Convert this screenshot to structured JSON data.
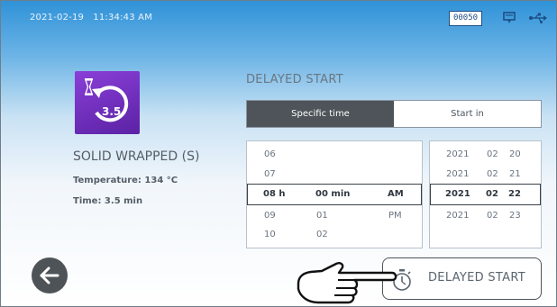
{
  "topbar": {
    "date": "2021-02-19",
    "time": "11:34:43 AM",
    "counter": "00050",
    "icons": [
      "card-icon",
      "usb-icon"
    ]
  },
  "program": {
    "icon_value": "3.5",
    "name": "SOLID WRAPPED (S)",
    "temperature": "Temperature: 134 °C",
    "time": "Time: 3.5 min"
  },
  "delayed_start": {
    "title": "DELAYED START",
    "tabs": [
      {
        "label": "Specific time",
        "active": true
      },
      {
        "label": "Start in",
        "active": false
      }
    ]
  },
  "time_picker": {
    "rows": [
      {
        "hour": "06",
        "minute": "",
        "ampm": ""
      },
      {
        "hour": "07",
        "minute": "",
        "ampm": ""
      },
      {
        "hour": "08 h",
        "minute": "00 min",
        "ampm": "AM",
        "selected": true
      },
      {
        "hour": "09",
        "minute": "01",
        "ampm": "PM"
      },
      {
        "hour": "10",
        "minute": "02",
        "ampm": ""
      }
    ]
  },
  "date_picker": {
    "rows": [
      {
        "year": "2021",
        "month": "02",
        "day": "20"
      },
      {
        "year": "2021",
        "month": "02",
        "day": "21"
      },
      {
        "year": "2021",
        "month": "02",
        "day": "22",
        "selected": true
      },
      {
        "year": "2021",
        "month": "02",
        "day": "23"
      }
    ]
  },
  "footer": {
    "delayed_button_label": "DELAYED START"
  },
  "colors": {
    "program_icon": "#6a2fbf",
    "active_tab": "#4e5459",
    "header_blue": "#2f92d8"
  }
}
